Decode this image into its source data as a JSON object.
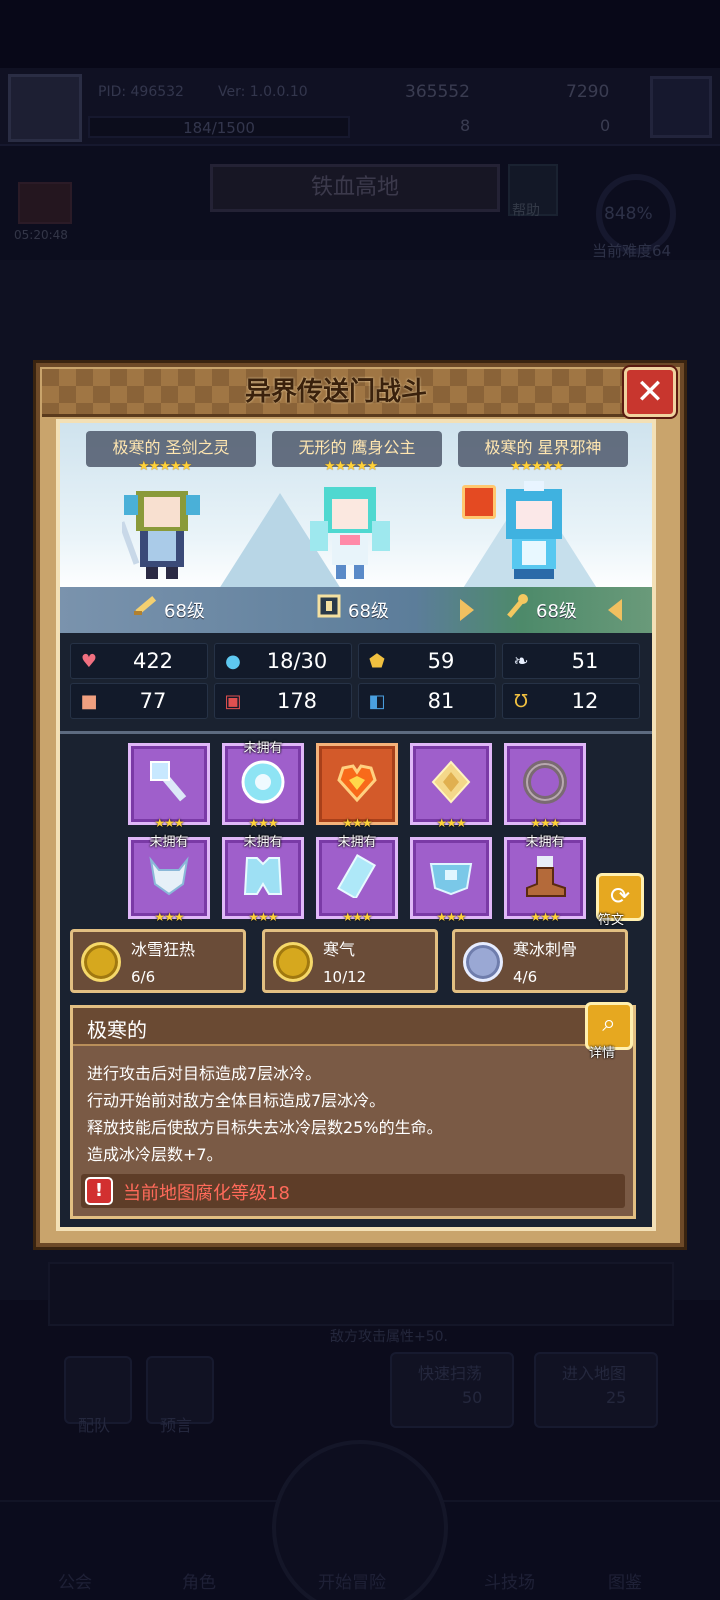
{
  "header": {
    "pid": "PID: 496532",
    "version": "Ver: 1.0.0.10",
    "currency1": "365552",
    "currency2": "7290",
    "exp": "184/1500",
    "resource1": "8",
    "resource2": "0"
  },
  "region": {
    "name": "铁血高地",
    "help_label": "帮助"
  },
  "timer": "05:20:48",
  "difficulty": {
    "percent": "848%",
    "label": "当前难度64"
  },
  "background_panel": {
    "note": "敌方攻击属性+50."
  },
  "background_buttons": [
    "配队",
    "预言",
    "快速扫荡",
    "进入地图"
  ],
  "background_costs": [
    "50",
    "25"
  ],
  "nav": [
    "公会",
    "角色",
    "开始冒险",
    "斗技场",
    "图鉴"
  ],
  "modal": {
    "title": "异界传送门战斗",
    "close_icon": "close-x-icon"
  },
  "enemies": [
    {
      "name": "极寒的 圣剑之灵",
      "stars": "★★★★★",
      "level": "68级",
      "level_icon": "sword-icon"
    },
    {
      "name": "无形的 鹰身公主",
      "stars": "★★★★★",
      "level": "68级",
      "level_icon": "shield-icon"
    },
    {
      "name": "极寒的 星界邪神",
      "stars": "★★★★★",
      "level": "68级",
      "level_icon": "staff-icon"
    }
  ],
  "stats": [
    {
      "icon": "heart-icon",
      "value": "422",
      "color": "#f07080"
    },
    {
      "icon": "mana-drop-icon",
      "value": "18/30",
      "color": "#5ec8f0"
    },
    {
      "icon": "shield-icon",
      "value": "59",
      "color": "#f0c040"
    },
    {
      "icon": "wing-icon",
      "value": "51",
      "color": "#e8f0ff"
    },
    {
      "icon": "fist-icon",
      "value": "77",
      "color": "#f0a080"
    },
    {
      "icon": "spellbook-icon",
      "value": "178",
      "color": "#e05050"
    },
    {
      "icon": "armor-icon",
      "value": "81",
      "color": "#4aa0e0"
    },
    {
      "icon": "horseshoe-icon",
      "value": "12",
      "color": "#f0c040"
    }
  ],
  "equipment": [
    {
      "icon": "ice-staff-icon",
      "stars": "★★★",
      "unowned": ""
    },
    {
      "icon": "ice-orb-icon",
      "stars": "★★★",
      "unowned": "未拥有"
    },
    {
      "icon": "fire-heart-amulet-icon",
      "stars": "★★★",
      "unowned": ""
    },
    {
      "icon": "golden-crystal-icon",
      "stars": "★★★",
      "unowned": ""
    },
    {
      "icon": "iron-ring-icon",
      "stars": "★★★",
      "unowned": ""
    },
    {
      "icon": "beast-helm-icon",
      "stars": "★★★",
      "unowned": "未拥有"
    },
    {
      "icon": "ice-armor-icon",
      "stars": "★★★",
      "unowned": "未拥有"
    },
    {
      "icon": "ice-bracer-icon",
      "stars": "★★★",
      "unowned": "未拥有"
    },
    {
      "icon": "ice-belt-icon",
      "stars": "★★★",
      "unowned": ""
    },
    {
      "icon": "leather-boots-icon",
      "stars": "★★★",
      "unowned": "未拥有"
    }
  ],
  "rune_label": "符文",
  "set_bonuses": [
    {
      "name": "冰雪狂热",
      "count": "6/6",
      "coin": "gold"
    },
    {
      "name": "寒气",
      "count": "10/12",
      "coin": "gold"
    },
    {
      "name": "寒冰刺骨",
      "count": "4/6",
      "coin": "silver"
    }
  ],
  "affix": {
    "title": "极寒的",
    "detail_label": "详情",
    "lines": [
      "进行攻击后对目标造成7层冰冷。",
      "行动开始前对敌方全体目标造成7层冰冷。",
      "释放技能后使敌方目标失去冰冷层数25%的生命。",
      "造成冰冷层数+7。"
    ],
    "warning": "当前地图腐化等级18"
  }
}
